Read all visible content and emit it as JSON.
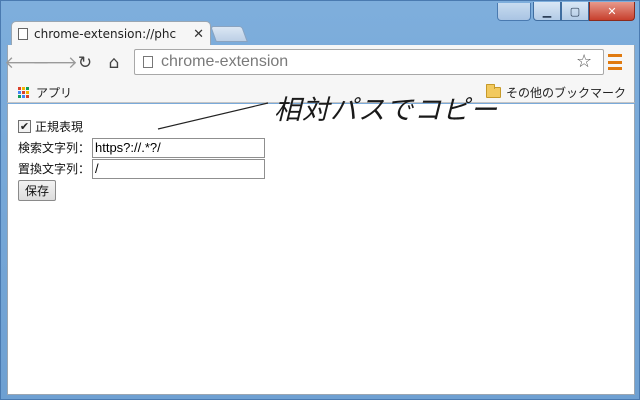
{
  "browser": {
    "tab": {
      "title": "chrome-extension://phc",
      "close": "✕"
    },
    "address_bar": {
      "value": "chrome-extension"
    },
    "icons": {
      "back": "back-arrow-icon",
      "forward": "forward-arrow-icon",
      "reload": "reload-icon",
      "home": "home-icon",
      "star": "bookmark-star-icon",
      "menu": "hamburger-menu-icon"
    },
    "bookmarks": {
      "apps_label": "アプリ",
      "other_label": "その他のブックマーク"
    },
    "colors": {
      "menu_accent": "#e07a10",
      "window_frame": "#6ea0d2"
    }
  },
  "form": {
    "regex_label": "正規表現",
    "regex_checked": true,
    "search_label": "検索文字列：",
    "search_value": "https?://.*?/",
    "replace_label": "置換文字列：",
    "replace_value": "/",
    "save_label": "保存"
  },
  "annotation": {
    "text": "相対パスでコピー"
  }
}
